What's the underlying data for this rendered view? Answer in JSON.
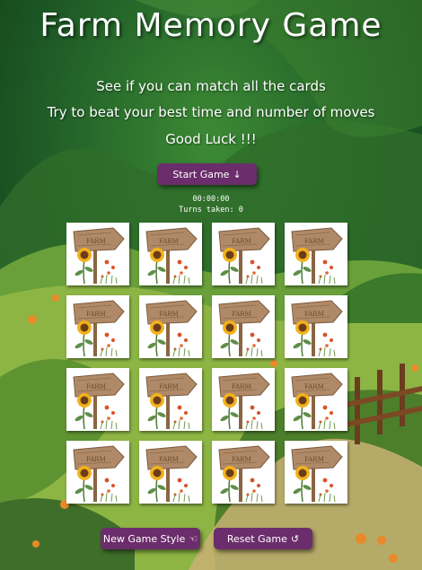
{
  "header": {
    "title": "Farm Memory Game"
  },
  "intro": {
    "line1": "See if you can match all the cards",
    "line2": "Try to beat your best time and number of moves",
    "line3": "Good Luck !!!"
  },
  "controls": {
    "start_label": "Start Game",
    "start_icon": "arrow-down-icon",
    "timer": "00:00:00",
    "turns": "Turns taken: 0",
    "new_style_label": "New Game Style",
    "new_style_icon": "hand-pointer-icon",
    "reset_label": "Reset Game",
    "reset_icon": "undo-icon"
  },
  "cards": {
    "rows": 4,
    "columns": 4,
    "face": "farm-sign-sunflower-card-back",
    "count": 16
  },
  "colors": {
    "button": "#6b2d6b",
    "background_dark": "#1f4d24",
    "background_light": "#3f8a2e"
  }
}
